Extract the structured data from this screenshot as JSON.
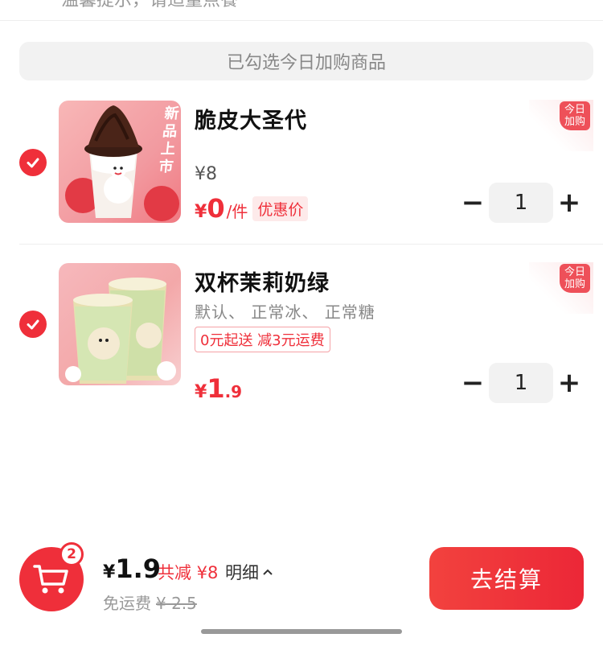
{
  "header": {
    "clipped_text": "温馨提示，请适量点餐"
  },
  "banner": {
    "label": "已勾选今日加购商品"
  },
  "items": [
    {
      "name": "脆皮大圣代",
      "orig_price": "¥8",
      "price_yen": "¥",
      "price_int": "0",
      "price_dec": "",
      "unit": "/件",
      "promo_tag": "优惠价",
      "badge": [
        "今日",
        "加购"
      ],
      "image_label": "新品上市",
      "qty": "1",
      "minus": "−",
      "plus": "+"
    },
    {
      "name": "双杯茉莉奶绿",
      "specs": "默认、 正常冰、 正常糖",
      "ship_tag": "0元起送 减3元运费",
      "price_yen": "¥",
      "price_int": "1",
      "price_dec": ".9",
      "badge": [
        "今日",
        "加购"
      ],
      "qty": "1",
      "minus": "−",
      "plus": "+"
    }
  ],
  "footer": {
    "cart_count": "2",
    "total_yen": "¥",
    "total_value": "1.9",
    "discount": "共减 ¥8",
    "detail_label": "明细",
    "shipping_label": "免运费",
    "shipping_old": "¥ 2.5",
    "checkout_label": "去结算"
  },
  "colors": {
    "accent": "#ef2f3a",
    "muted": "#999999",
    "chip_bg": "#f2f2f2"
  }
}
